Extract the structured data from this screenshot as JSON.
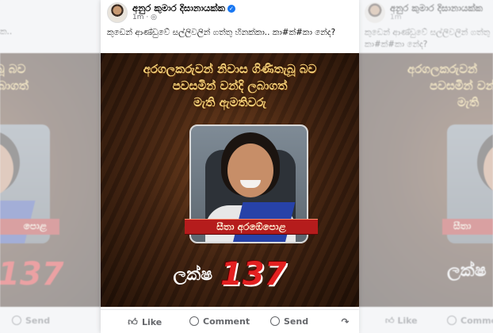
{
  "post": {
    "author": "අනුර කුමාර දිසානායක්ක",
    "time": "1m",
    "caption": "කුඩෙන් ආණ්ඩුවේ සල්ලිවලින් ගත්තු හිනක්කා.. කා#ක්#කා නේද?",
    "headline_1": "අරගලකරුවන් නිවාස ගිණිතැබූ බව",
    "headline_2": "පවසමින් වන්දි ලබාගත්",
    "headline_3": "මැති ඇමතිවරු",
    "person_name": "සීතා අරඹේපොළ",
    "amount_label": "ලක්ෂ",
    "amount_value": "137",
    "actions": {
      "like": "Like",
      "comment": "Comment",
      "send": "Send"
    }
  },
  "ghost_left": {
    "caption": "ක..",
    "headline": "ගිණිතැබූ බව",
    "headline_2": "ලබාගත්",
    "person_name": "පොළ",
    "amount_value": "137",
    "send": "Send"
  },
  "ghost_right": {
    "author": "අනුර කුමාර දිසානායක්ක",
    "time": "1m",
    "caption_1": "කුඩෙන් ආණ්ඩුවේ සල්ලිවලින් ගත්තු හිනක්කා..",
    "caption_2": "කා#ක්#කා නේද?",
    "headline": "අරගලකරුවන්",
    "headline_2": "පවසමින් වන්",
    "headline_3": "මැති",
    "person_name": "සීතා",
    "amount_label": "ලක්ෂ",
    "like": "Like",
    "comment": "Commen"
  },
  "colors": {
    "facebook_blue": "#1877f2",
    "headline_gold": "#f6d37a",
    "amount_red": "#e32020",
    "name_band_red": "#b51c1c"
  }
}
